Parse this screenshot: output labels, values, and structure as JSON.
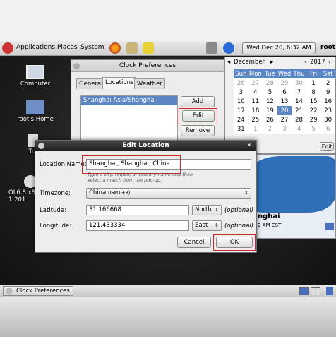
{
  "panel": {
    "menus": [
      "Applications",
      "Places",
      "System"
    ],
    "clock": "Wed Dec 20,  6:32 AM",
    "user": "root"
  },
  "desktop": {
    "computer_label": "Computer",
    "home_label": "root's Home",
    "trash_label": "Tra",
    "dvd_label_1": "OL6.8 x8",
    "dvd_label_2": "1 201"
  },
  "clock_prefs": {
    "title": "Clock Preferences",
    "tabs": [
      "General",
      "Locations",
      "Weather"
    ],
    "location_item": "Shanghai  Asia/Shanghai",
    "buttons": {
      "add": "Add",
      "edit": "Edit",
      "remove": "Remove"
    }
  },
  "calendar": {
    "month": "December",
    "year": "2017",
    "weekdays": [
      "Sun",
      "Mon",
      "Tue",
      "Wed",
      "Thu",
      "Fri",
      "Sat"
    ],
    "weeks": [
      [
        "26",
        "27",
        "28",
        "29",
        "30",
        "1",
        "2"
      ],
      [
        "3",
        "4",
        "5",
        "6",
        "7",
        "8",
        "9"
      ],
      [
        "10",
        "11",
        "12",
        "13",
        "14",
        "15",
        "16"
      ],
      [
        "17",
        "18",
        "19",
        "20",
        "21",
        "22",
        "23"
      ],
      [
        "24",
        "25",
        "26",
        "27",
        "28",
        "29",
        "30"
      ],
      [
        "31",
        "1",
        "2",
        "3",
        "4",
        "5",
        "6"
      ]
    ],
    "today": "20",
    "edit_label": "Edit",
    "city": "nghai",
    "city_time": "2 AM CST"
  },
  "edit_location": {
    "title": "Edit Location",
    "close": "×",
    "location_label": "Location Name:",
    "location_value": "Shanghai, Shanghai, China",
    "hint": "Type a city, region, or country name and then select a match from the pop-up.",
    "timezone_label": "Timezone:",
    "timezone_value": "China",
    "timezone_offset": "(GMT+8)",
    "latitude_label": "Latitude:",
    "latitude_value": "31.166668",
    "latitude_dir": "North",
    "longitude_label": "Longitude:",
    "longitude_value": "121.433334",
    "longitude_dir": "East",
    "optional": "(optional)",
    "cancel": "Cancel",
    "ok": "OK"
  },
  "taskbar": {
    "window_button": "Clock Preferences"
  },
  "colors": {
    "selection_blue": "#5b86c6",
    "highlight_red": "#d0242e"
  }
}
